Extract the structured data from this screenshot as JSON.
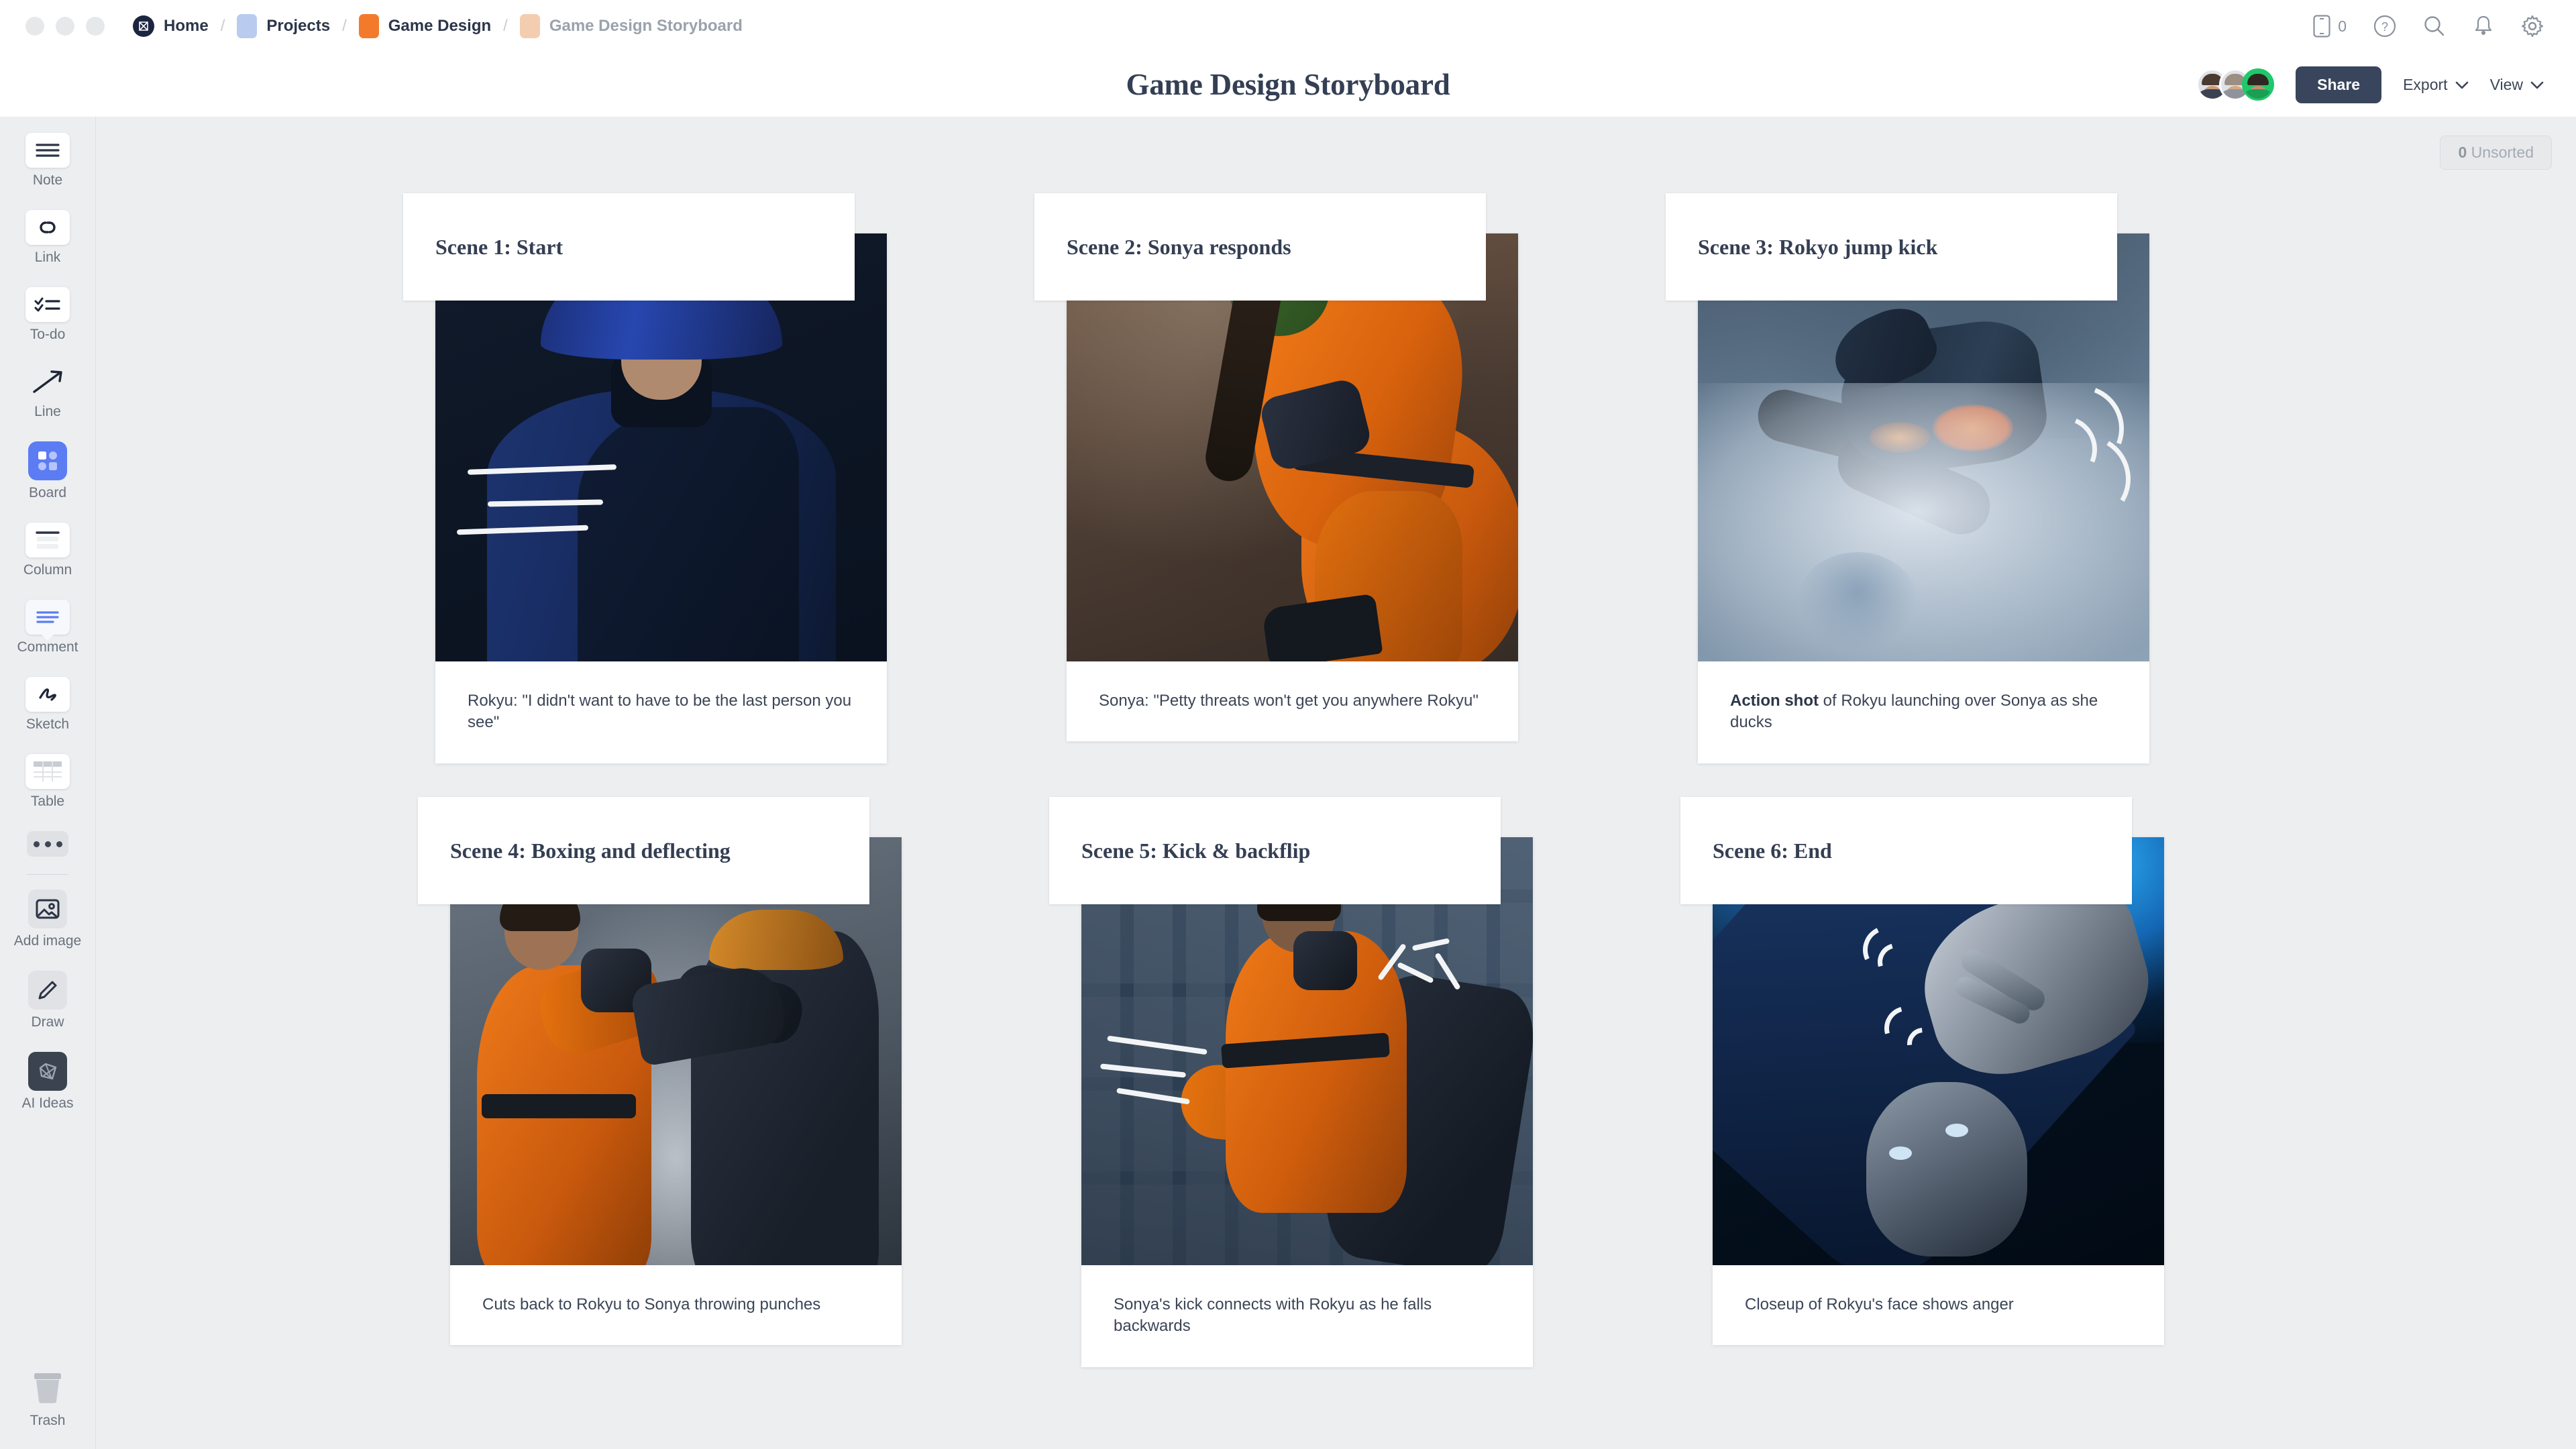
{
  "window": {
    "dots": [
      "close",
      "minimize",
      "maximize"
    ]
  },
  "breadcrumb": {
    "items": [
      {
        "label": "Home",
        "icon": "milanote-logo-icon",
        "chip_color": "#1c2540",
        "muted": false
      },
      {
        "label": "Projects",
        "icon": "folder-chip",
        "chip_color": "#b9cbef",
        "muted": false
      },
      {
        "label": "Game Design",
        "icon": "folder-chip",
        "chip_color": "#f47a2b",
        "muted": false
      },
      {
        "label": "Game Design Storyboard",
        "icon": "folder-chip",
        "chip_color": "#f4cdb0",
        "muted": true
      }
    ],
    "separator": "/"
  },
  "topbar_icons": [
    {
      "name": "device-icon",
      "label": "0"
    },
    {
      "name": "help-icon",
      "label": "?"
    },
    {
      "name": "search-icon",
      "label": ""
    },
    {
      "name": "notifications-bell-icon",
      "label": ""
    },
    {
      "name": "settings-gear-icon",
      "label": ""
    }
  ],
  "header": {
    "title": "Game Design Storyboard",
    "share_label": "Share",
    "export_label": "Export",
    "view_label": "View",
    "avatar_count": 3,
    "accent_online": "#1fc86a",
    "share_bg": "#38455c"
  },
  "sidebar": {
    "tools": [
      {
        "label": "Note",
        "icon": "note-icon",
        "style": "white",
        "active": false
      },
      {
        "label": "Link",
        "icon": "link-icon",
        "style": "white",
        "active": false
      },
      {
        "label": "To-do",
        "icon": "todo-icon",
        "style": "white",
        "active": false
      },
      {
        "label": "Line",
        "icon": "line-arrow-icon",
        "style": "plain",
        "active": false
      },
      {
        "label": "Board",
        "icon": "board-icon",
        "style": "accent",
        "active": true
      },
      {
        "label": "Column",
        "icon": "column-icon",
        "style": "white",
        "active": false
      },
      {
        "label": "Comment",
        "icon": "comment-icon",
        "style": "white",
        "active": false
      },
      {
        "label": "Sketch",
        "icon": "sketch-icon",
        "style": "white",
        "active": false
      },
      {
        "label": "Table",
        "icon": "table-icon",
        "style": "white",
        "active": false
      },
      {
        "label": "",
        "icon": "more-dots-icon",
        "style": "dots",
        "active": false
      }
    ],
    "secondary_tools": [
      {
        "label": "Add image",
        "icon": "image-icon",
        "style": "gray"
      },
      {
        "label": "Draw",
        "icon": "pencil-icon",
        "style": "gray"
      },
      {
        "label": "AI Ideas",
        "icon": "ai-gem-icon",
        "style": "dark"
      }
    ],
    "trash": {
      "label": "Trash",
      "icon": "trash-icon"
    },
    "accent_color": "#5b7cf3"
  },
  "canvas": {
    "unsorted_count": "0",
    "unsorted_label": "Unsorted",
    "background": "#eceef0"
  },
  "scenes": [
    {
      "title": "Scene 1: Start",
      "caption_bold": "",
      "caption": "Rokyu: \"I didn't want to have to be the last person you see\"",
      "image_alt": "Rokyu in blue straw hat and robe in a dark alley",
      "art": "art1"
    },
    {
      "title": "Scene 2: Sonya responds",
      "caption_bold": "",
      "caption": "Sonya: \"Petty threats won't get you anywhere Rokyu\"",
      "image_alt": "Sonya in orange bodysuit taping her gloves",
      "art": "art2"
    },
    {
      "title": "Scene 3: Rokyo jump kick",
      "caption_bold": "Action shot",
      "caption": " of Rokyu launching over Sonya as she ducks",
      "image_alt": "Rokyu flying jump kick through blue smoke",
      "art": "art3"
    },
    {
      "title": "Scene 4: Boxing and deflecting",
      "caption_bold": "",
      "caption": "Cuts back to Rokyu to Sonya throwing punches",
      "image_alt": "Sonya boxing while Rokyu deflects with his cloak",
      "art": "art4"
    },
    {
      "title": "Scene 5: Kick & backflip",
      "caption_bold": "",
      "caption": "Sonya's kick connects with Rokyu as he falls backwards",
      "image_alt": "Sonya high kick in a warehouse with tall windows",
      "art": "art5"
    },
    {
      "title": "Scene 6: End",
      "caption_bold": "",
      "caption": "Closeup of Rokyu's face shows anger",
      "image_alt": "Closeup of Rokyu's face under the hat brim",
      "art": "art6"
    }
  ]
}
